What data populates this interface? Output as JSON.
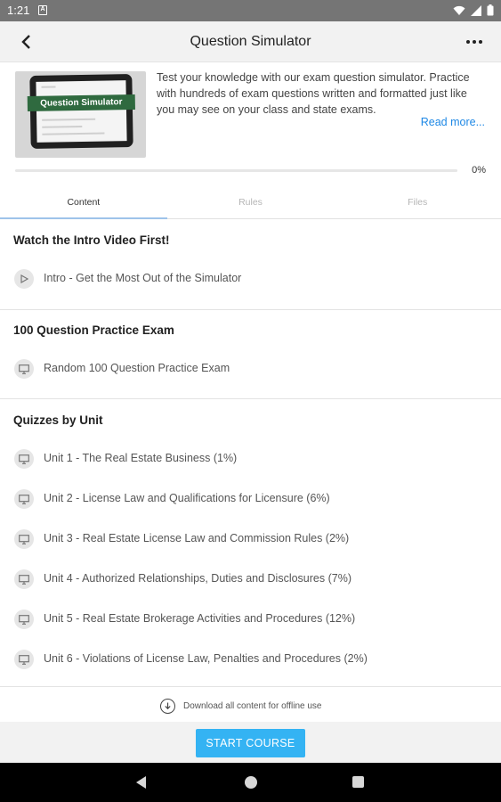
{
  "status_bar": {
    "time": "1:21",
    "notification_glyph": "A"
  },
  "app_bar": {
    "title": "Question Simulator",
    "back_icon": "chevron-left-icon",
    "more_icon": "more-horizontal-icon"
  },
  "course": {
    "thumbnail_text": "Question Simulator",
    "description": "Test your knowledge with our exam question simulator. Practice with hundreds of exam questions written and formatted just like you may see on your class and state exams.",
    "read_more": "Read more...",
    "progress_percent": 0,
    "progress_label": "0%"
  },
  "tabs": [
    {
      "label": "Content",
      "active": true
    },
    {
      "label": "Rules",
      "active": false
    },
    {
      "label": "Files",
      "active": false
    }
  ],
  "sections": [
    {
      "title": "Watch the Intro Video First!",
      "items": [
        {
          "label": "Intro - Get the Most Out of the Simulator",
          "icon": "play-icon"
        }
      ]
    },
    {
      "title": "100 Question Practice Exam",
      "items": [
        {
          "label": "Random 100 Question Practice Exam",
          "icon": "monitor-icon"
        }
      ]
    },
    {
      "title": "Quizzes by Unit",
      "items": [
        {
          "label": "Unit 1 - The Real Estate Business (1%)",
          "icon": "monitor-icon"
        },
        {
          "label": "Unit 2 - License Law and Qualifications for Licensure (6%)",
          "icon": "monitor-icon"
        },
        {
          "label": "Unit 3 - Real Estate License Law and Commission Rules (2%)",
          "icon": "monitor-icon"
        },
        {
          "label": "Unit 4 - Authorized Relationships, Duties and Disclosures (7%)",
          "icon": "monitor-icon"
        },
        {
          "label": "Unit 5 - Real Estate Brokerage Activities and Procedures (12%)",
          "icon": "monitor-icon"
        },
        {
          "label": "Unit 6 - Violations of License Law, Penalties and Procedures (2%)",
          "icon": "monitor-icon"
        }
      ]
    }
  ],
  "download": {
    "label": "Download all content for offline use",
    "icon": "download-circle-icon"
  },
  "start_button": {
    "label": "START COURSE"
  },
  "colors": {
    "accent": "#34b3f3",
    "link": "#1e88e5",
    "thumbnail_band": "#2f6a3f"
  }
}
